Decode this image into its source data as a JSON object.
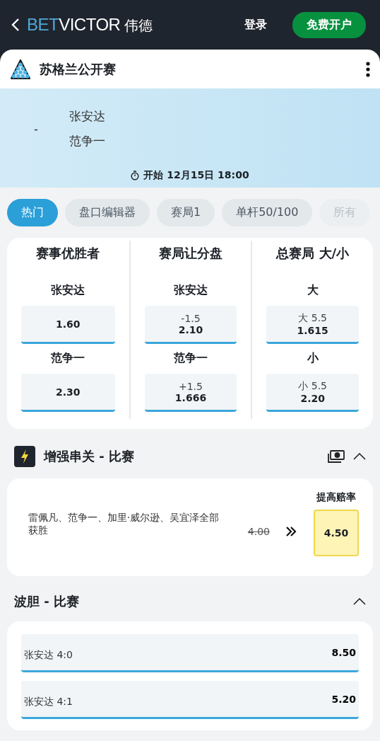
{
  "header": {
    "logo": {
      "accent": "BET",
      "rest": "VICTOR",
      "suffix": "伟德"
    },
    "login": "登录",
    "signup": "免费开户"
  },
  "event": {
    "title": "苏格兰公开赛",
    "score": "-",
    "players": [
      "张安达",
      "范争一"
    ],
    "start": "开始 12月15日 18:00"
  },
  "tabs": [
    {
      "label": "热门",
      "selected": true
    },
    {
      "label": "盘口编辑器",
      "selected": false
    },
    {
      "label": "赛局1",
      "selected": false
    },
    {
      "label": "单杆50/100",
      "selected": false
    },
    {
      "label": "所有",
      "selected": false
    }
  ],
  "markets": [
    {
      "title": "赛事优胜者",
      "selections": [
        {
          "name": "张安达",
          "odds": "1.60"
        },
        {
          "name": "范争一",
          "odds": "2.30"
        }
      ]
    },
    {
      "title": "赛局让分盘",
      "selections": [
        {
          "name": "张安达",
          "line": "-1.5",
          "odds": "2.10"
        },
        {
          "name": "范争一",
          "line": "+1.5",
          "odds": "1.666"
        }
      ]
    },
    {
      "title": "总赛局 大/小",
      "selections": [
        {
          "name": "大",
          "line": "大 5.5",
          "odds": "1.615"
        },
        {
          "name": "小",
          "line": "小 5.5",
          "odds": "2.20"
        }
      ]
    }
  ],
  "boost": {
    "title": "增强串关 - 比赛",
    "expanded": true,
    "label": "提高赔率",
    "description": "雷佩凡、范争一、加里·威尔逊、吴宜泽全部获胜",
    "old_odds": "4.00",
    "new_odds": "4.50"
  },
  "correct_score": {
    "title": "波胆 - 比赛",
    "expanded": true,
    "rows": [
      {
        "label": "张安达 4:0",
        "odds": "8.50"
      },
      {
        "label": "张安达 4:1",
        "odds": "5.20"
      }
    ]
  }
}
